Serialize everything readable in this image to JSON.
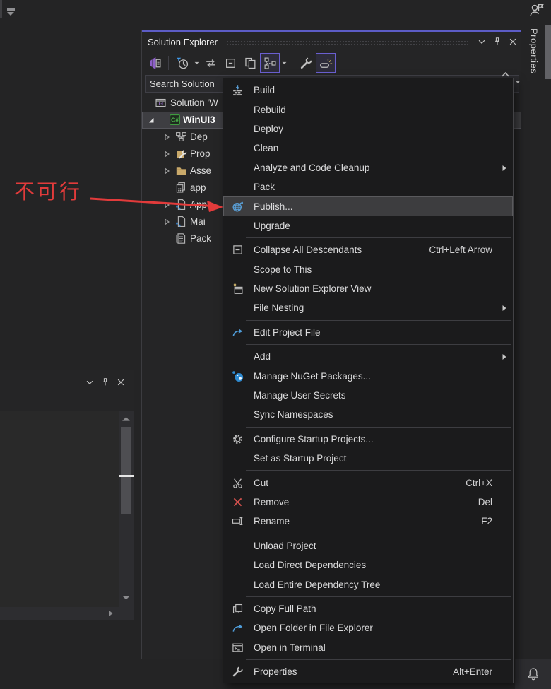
{
  "colors": {
    "accent_purple": "#5c5cc6",
    "toolbar_selected_border": "#6a5fd0",
    "annotation_red": "#e23b3b",
    "tree_selection_bg": "#3e3e42",
    "menu_bg": "#1b1b1c",
    "menu_highlight_bg": "#3d3d3f",
    "nuget_blue": "#2e8ad0",
    "link_blue": "#4f9cd8",
    "folder_gold": "#c9a96a"
  },
  "solution_explorer": {
    "title": "Solution Explorer",
    "search_text": "Search Solution",
    "toolbar": [
      {
        "name": "solution-home"
      },
      {
        "sep": true
      },
      {
        "name": "pending-changes-filter",
        "dropdown": true
      },
      {
        "name": "sync-with-active-document"
      },
      {
        "name": "collapse-all"
      },
      {
        "name": "preview-selected-items"
      },
      {
        "name": "show-all-files",
        "selected": true,
        "dropdown": true
      },
      {
        "sep": true
      },
      {
        "name": "properties-tool"
      },
      {
        "name": "track-active-item",
        "selected": true
      }
    ],
    "tree": [
      {
        "label": "Solution 'W",
        "icon": "solution",
        "kind": "solution"
      },
      {
        "label": "WinUI3",
        "icon": "csharp-project",
        "kind": "project",
        "arrow": "expanded",
        "bold": true,
        "selected": true
      },
      {
        "label": "Dep",
        "icon": "dependencies",
        "kind": "child",
        "arrow": "collapsed"
      },
      {
        "label": "Prop",
        "icon": "properties-folder",
        "kind": "child",
        "arrow": "collapsed"
      },
      {
        "label": "Asse",
        "icon": "folder",
        "kind": "child",
        "arrow": "collapsed"
      },
      {
        "label": "app",
        "icon": "manifest-file",
        "kind": "child"
      },
      {
        "label": "App",
        "icon": "xaml-file",
        "kind": "child",
        "arrow": "collapsed"
      },
      {
        "label": "Mai",
        "icon": "xaml-file",
        "kind": "child",
        "arrow": "collapsed"
      },
      {
        "label": "Pack",
        "icon": "appx-manifest",
        "kind": "child"
      }
    ]
  },
  "context_menu": {
    "items": [
      {
        "label": "Build",
        "icon": "build"
      },
      {
        "label": "Rebuild"
      },
      {
        "label": "Deploy"
      },
      {
        "label": "Clean"
      },
      {
        "label": "Analyze and Code Cleanup",
        "submenu": true
      },
      {
        "label": "Pack"
      },
      {
        "label": "Publish...",
        "icon": "publish-globe",
        "highlighted": true
      },
      {
        "label": "Upgrade"
      },
      {
        "separator": true
      },
      {
        "label": "Collapse All Descendants",
        "icon": "collapse-descendants",
        "shortcut": "Ctrl+Left Arrow"
      },
      {
        "label": "Scope to This"
      },
      {
        "label": "New Solution Explorer View",
        "icon": "new-solution-view"
      },
      {
        "label": "File Nesting",
        "submenu": true
      },
      {
        "separator": true
      },
      {
        "label": "Edit Project File",
        "icon": "edit-arrow"
      },
      {
        "separator": true
      },
      {
        "label": "Add",
        "submenu": true
      },
      {
        "label": "Manage NuGet Packages...",
        "icon": "nuget"
      },
      {
        "label": "Manage User Secrets"
      },
      {
        "label": "Sync Namespaces"
      },
      {
        "separator": true
      },
      {
        "label": "Configure Startup Projects...",
        "icon": "gear"
      },
      {
        "label": "Set as Startup Project"
      },
      {
        "separator": true
      },
      {
        "label": "Cut",
        "icon": "scissors",
        "shortcut": "Ctrl+X"
      },
      {
        "label": "Remove",
        "icon": "red-x",
        "shortcut": "Del"
      },
      {
        "label": "Rename",
        "icon": "rename",
        "shortcut": "F2"
      },
      {
        "separator": true
      },
      {
        "label": "Unload Project"
      },
      {
        "label": "Load Direct Dependencies"
      },
      {
        "label": "Load Entire Dependency Tree"
      },
      {
        "separator": true
      },
      {
        "label": "Copy Full Path",
        "icon": "copy"
      },
      {
        "label": "Open Folder in File Explorer",
        "icon": "edit-arrow"
      },
      {
        "label": "Open in Terminal",
        "icon": "terminal"
      },
      {
        "separator": true
      },
      {
        "label": "Properties",
        "icon": "wrench",
        "shortcut": "Alt+Enter"
      }
    ]
  },
  "right_tab": {
    "label": "Properties"
  },
  "annotation": {
    "text": "不可行"
  }
}
